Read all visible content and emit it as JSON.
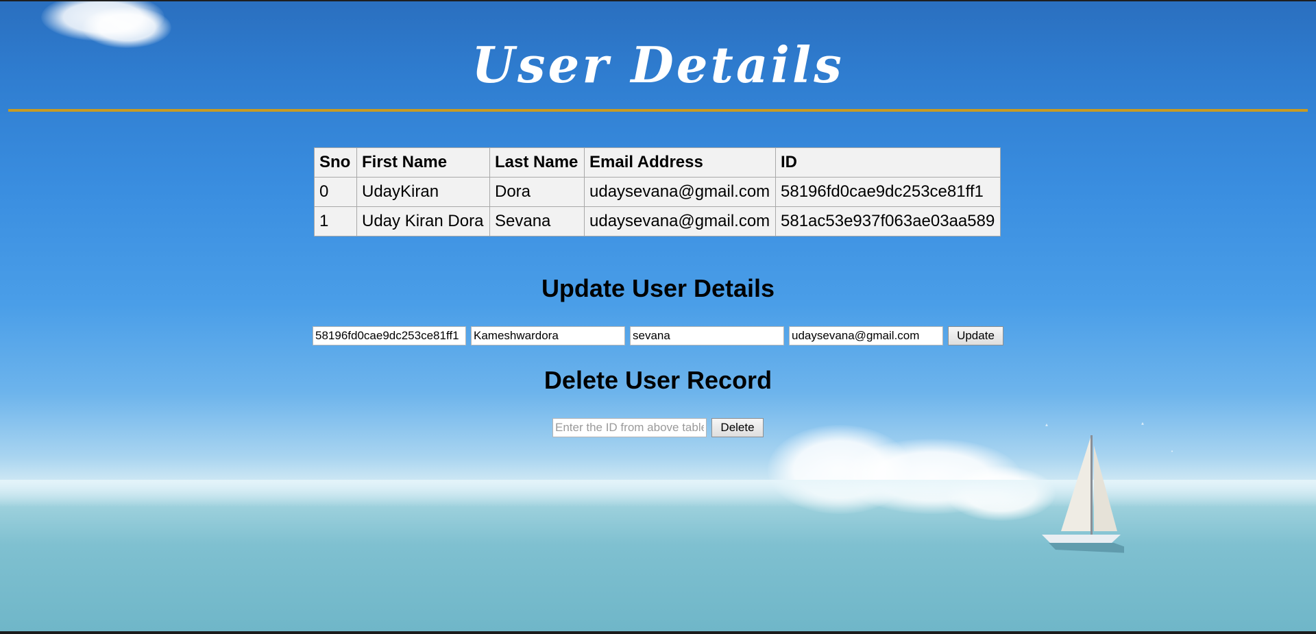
{
  "page": {
    "title": "User Details"
  },
  "users_table": {
    "headers": {
      "sno": "Sno",
      "first_name": "First Name",
      "last_name": "Last Name",
      "email": "Email Address",
      "id": "ID"
    },
    "rows": [
      {
        "sno": "0",
        "first_name": "UdayKiran",
        "last_name": "Dora",
        "email": "udaysevana@gmail.com",
        "id": "58196fd0cae9dc253ce81ff1"
      },
      {
        "sno": "1",
        "first_name": "Uday Kiran Dora",
        "last_name": "Sevana",
        "email": "udaysevana@gmail.com",
        "id": "581ac53e937f063ae03aa589"
      }
    ]
  },
  "update_section": {
    "heading": "Update User Details",
    "id_value": "58196fd0cae9dc253ce81ff1",
    "first_name_value": "Kameshwardora",
    "last_name_value": "sevana",
    "email_value": "udaysevana@gmail.com",
    "button_label": "Update"
  },
  "delete_section": {
    "heading": "Delete User Record",
    "id_placeholder": "Enter the ID from above table",
    "id_value": "",
    "button_label": "Delete"
  },
  "colors": {
    "title_text": "#ffffff",
    "rule": "#c89b22",
    "table_cell_bg": "#f2f2f2",
    "sky": "#3a8ee0"
  }
}
